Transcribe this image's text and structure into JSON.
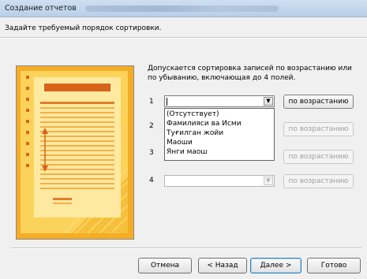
{
  "window": {
    "title": "Создание отчетов"
  },
  "prompt": "Задайте требуемый порядок сортировки.",
  "description": "Допускается сортировка записей по возрастанию или по убыванию, включающая до 4 полей.",
  "sort_fields": [
    {
      "number": "1",
      "value": "",
      "button": "по возрастанию",
      "enabled": true
    },
    {
      "number": "2",
      "value": "",
      "button": "по возрастанию",
      "enabled": false
    },
    {
      "number": "3",
      "value": "",
      "button": "по возрастанию",
      "enabled": false
    },
    {
      "number": "4",
      "value": "",
      "button": "по возрастанию",
      "enabled": false
    }
  ],
  "dropdown_options": [
    "(Отсутствует)",
    "Фамилияси ва Исми",
    "Туғилган жойи",
    "Маоши",
    "Янги маош"
  ],
  "footer": {
    "cancel": "Отмена",
    "back": "< Назад",
    "next": "Далее >",
    "finish": "Готово"
  },
  "colors": {
    "illustration_bg": "#f7b52a",
    "illustration_panel": "#fde9a0",
    "illustration_header": "#d9621a"
  }
}
